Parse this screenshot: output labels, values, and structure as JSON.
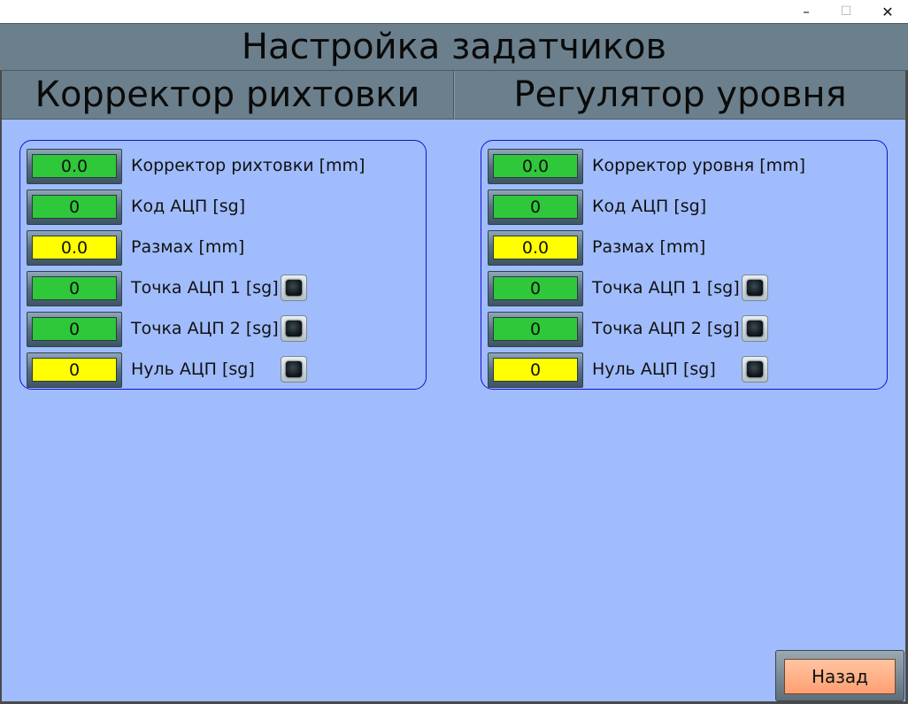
{
  "window": {
    "minimize": "–",
    "maximize": "☐",
    "close": "✕"
  },
  "title": "Настройка задатчиков",
  "sections": [
    {
      "title": "Корректор рихтовки",
      "rows": [
        {
          "value": "0.0",
          "color": "green",
          "label": "Корректор рихтовки [mm]",
          "led": false
        },
        {
          "value": "0",
          "color": "green",
          "label": "Код АЦП [sg]",
          "led": false
        },
        {
          "value": "0.0",
          "color": "yellow",
          "label": "Размах [mm]",
          "led": false
        },
        {
          "value": "0",
          "color": "green",
          "label": "Точка АЦП 1 [sg]",
          "led": true
        },
        {
          "value": "0",
          "color": "green",
          "label": "Точка АЦП 2 [sg]",
          "led": true
        },
        {
          "value": "0",
          "color": "yellow",
          "label": "Нуль АЦП [sg]",
          "led": true
        }
      ]
    },
    {
      "title": "Регулятор уровня",
      "rows": [
        {
          "value": "0.0",
          "color": "green",
          "label": "Корректор уровня [mm]",
          "led": false
        },
        {
          "value": "0",
          "color": "green",
          "label": "Код АЦП [sg]",
          "led": false
        },
        {
          "value": "0.0",
          "color": "yellow",
          "label": "Размах [mm]",
          "led": false
        },
        {
          "value": "0",
          "color": "green",
          "label": "Точка АЦП 1 [sg]",
          "led": true
        },
        {
          "value": "0",
          "color": "green",
          "label": "Точка АЦП 2 [sg]",
          "led": true
        },
        {
          "value": "0",
          "color": "yellow",
          "label": "Нуль АЦП [sg]",
          "led": true
        }
      ]
    }
  ],
  "back_label": "Назад",
  "colors": {
    "background": "#a0bcfc",
    "header": "#6b808c",
    "green": "#2ec83a",
    "yellow": "#ffff00",
    "button": "#ff9f72"
  }
}
